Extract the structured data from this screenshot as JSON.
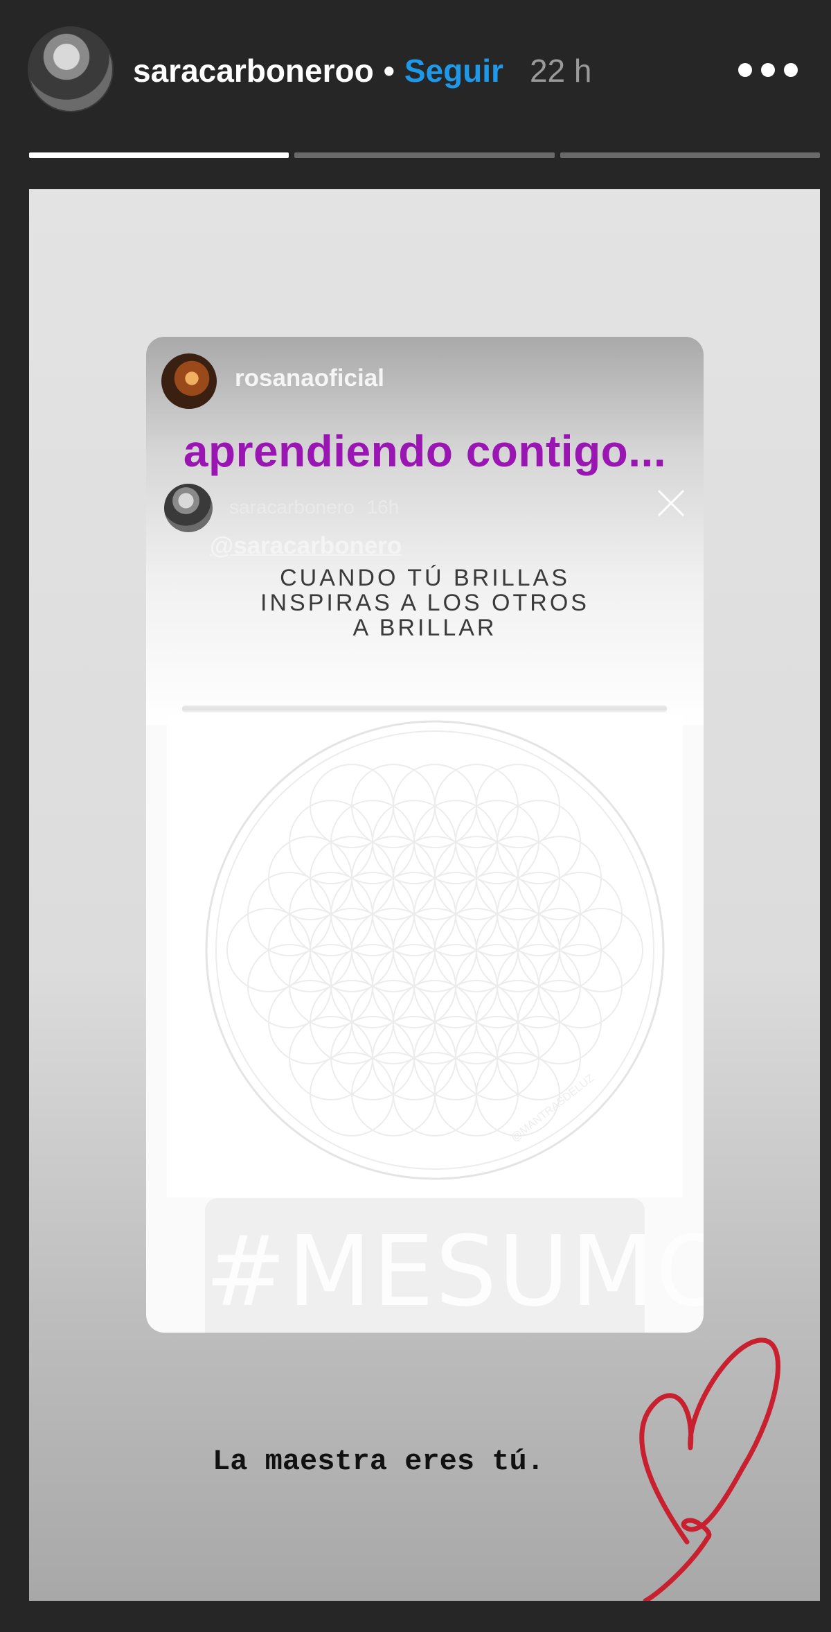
{
  "header": {
    "username": "saracarboneroo",
    "separator": "•",
    "follow_label": "Seguir",
    "time": "22 h",
    "progress": [
      1.0,
      0.0,
      0.0
    ]
  },
  "story": {
    "card": {
      "username": "rosanaoficial",
      "title": "aprendiendo contigo...",
      "inner_username": "saracarbonero",
      "inner_time": "16h",
      "mention": "@saracarbonero",
      "quote_lines": [
        "CUANDO TÚ BRILLAS",
        "INSPIRAS A LOS OTROS",
        "A BRILLAR"
      ],
      "watermark": "@MANTRASDELUZ",
      "hashtag": "#MESUMO"
    },
    "caption": "La maestra eres tú.",
    "icons": {
      "more": "more-horizontal-icon",
      "close": "close-icon",
      "heart": "heart-icon"
    },
    "colors": {
      "follow": "#1e98e8",
      "title": "#9a16b3",
      "heart": "#c8202e"
    }
  }
}
